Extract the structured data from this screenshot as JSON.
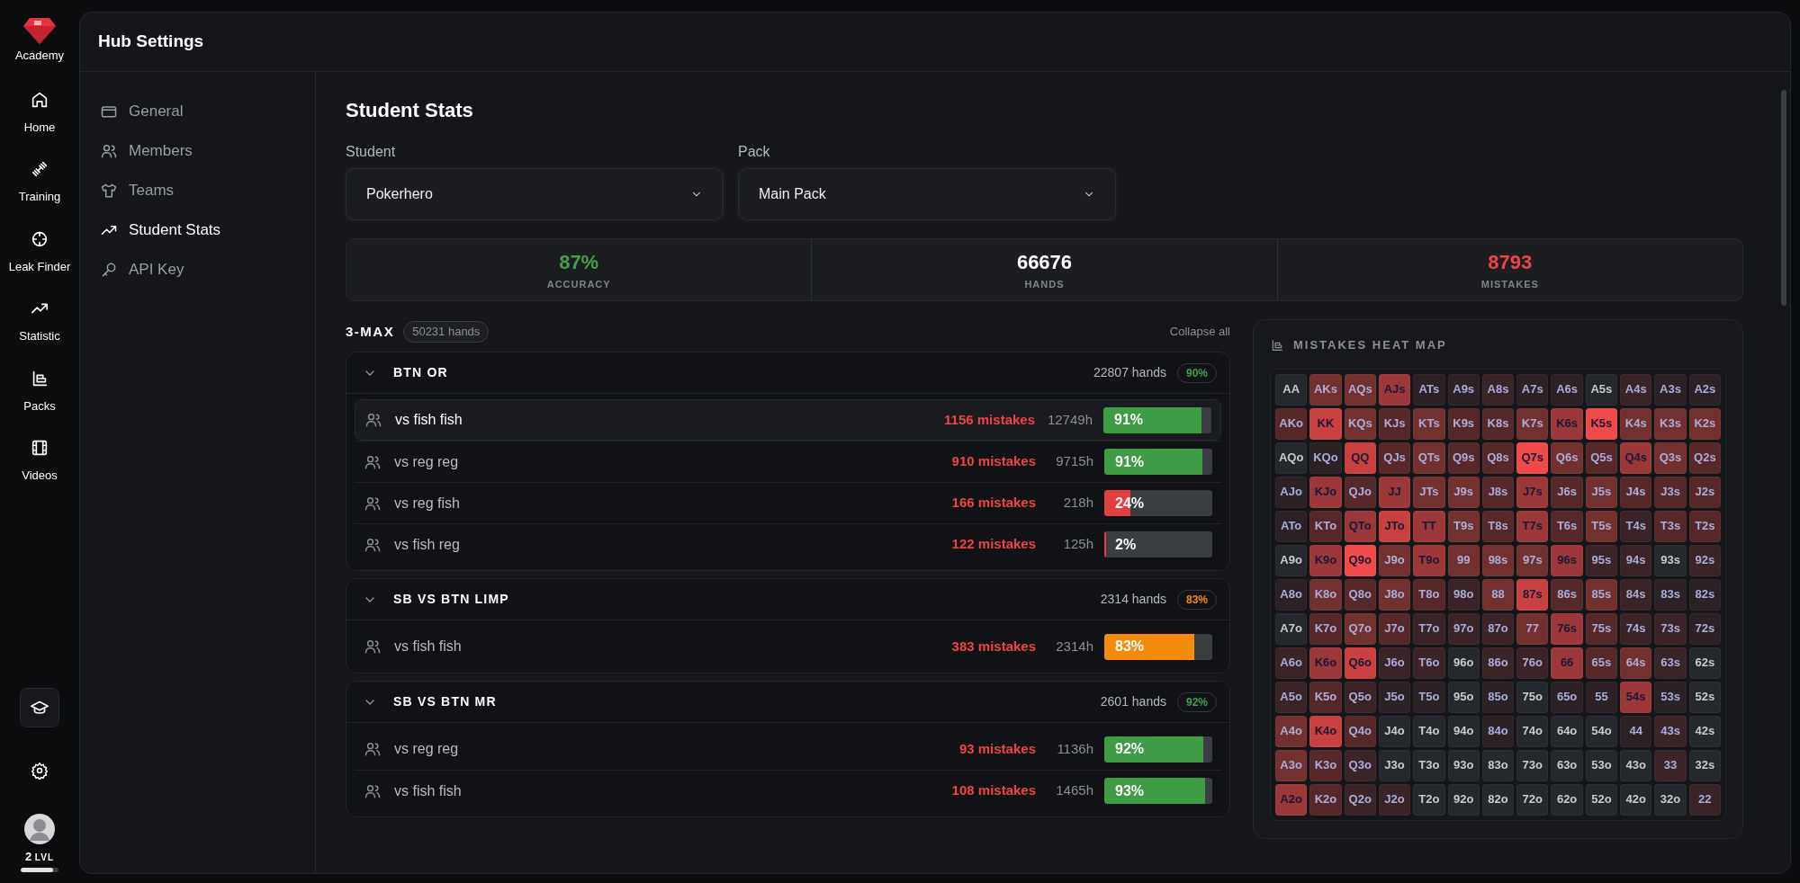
{
  "rail": {
    "logo_label": "Academy",
    "items": [
      {
        "label": "Home"
      },
      {
        "label": "Training"
      },
      {
        "label": "Leak Finder"
      },
      {
        "label": "Statistic"
      },
      {
        "label": "Packs"
      },
      {
        "label": "Videos"
      }
    ],
    "level": {
      "value": "2",
      "unit": "LVL",
      "level": 0.85
    }
  },
  "window": {
    "title": "Hub Settings"
  },
  "settings_nav": [
    {
      "label": "General",
      "selected": false
    },
    {
      "label": "Members",
      "selected": false
    },
    {
      "label": "Teams",
      "selected": false
    },
    {
      "label": "Student Stats",
      "selected": true
    },
    {
      "label": "API Key",
      "selected": false
    }
  ],
  "page_title": "Student Stats",
  "dropdowns": [
    {
      "label": "Student",
      "value": "Pokerhero"
    },
    {
      "label": "Pack",
      "value": "Main Pack"
    }
  ],
  "summary": [
    {
      "value": "87%",
      "label": "ACCURACY",
      "color": "#43a047"
    },
    {
      "value": "66676",
      "label": "HANDS",
      "color": "#ffffff"
    },
    {
      "value": "8793",
      "label": "MISTAKES",
      "color": "#ef4444"
    }
  ],
  "section": {
    "title": "3-MAX",
    "count": "50231 hands",
    "action": "Collapse all"
  },
  "groups": [
    {
      "title": "BTN OR",
      "hands": "22807 hands",
      "accuracy": "90%",
      "color": "#43a047",
      "expanded": true,
      "rows": [
        {
          "label": "vs fish fish",
          "mistakes": "1156 mistakes",
          "hands": "12749h",
          "percent": "91%",
          "level": 0.91,
          "color": "#3e9d44",
          "selected": true
        },
        {
          "label": "vs reg reg",
          "mistakes": "910 mistakes",
          "hands": "9715h",
          "percent": "91%",
          "level": 0.91,
          "color": "#3e9d44",
          "selected": false
        },
        {
          "label": "vs reg fish",
          "mistakes": "166 mistakes",
          "hands": "218h",
          "percent": "24%",
          "level": 0.24,
          "color": "#e04040",
          "selected": false
        },
        {
          "label": "vs fish reg",
          "mistakes": "122 mistakes",
          "hands": "125h",
          "percent": "2%",
          "level": 0.02,
          "color": "#e04040",
          "selected": false
        }
      ]
    },
    {
      "title": "SB VS BTN LIMP",
      "hands": "2314 hands",
      "accuracy": "83%",
      "color": "#f58a0b",
      "expanded": true,
      "rows": [
        {
          "label": "vs fish fish",
          "mistakes": "383 mistakes",
          "hands": "2314h",
          "percent": "83%",
          "level": 0.83,
          "color": "#f58a0b",
          "selected": false
        }
      ]
    },
    {
      "title": "SB VS BTN MR",
      "hands": "2601 hands",
      "accuracy": "92%",
      "color": "#43a047",
      "expanded": true,
      "rows": [
        {
          "label": "vs reg reg",
          "mistakes": "93 mistakes",
          "hands": "1136h",
          "percent": "92%",
          "level": 0.92,
          "color": "#3e9d44",
          "selected": false
        },
        {
          "label": "vs fish fish",
          "mistakes": "108 mistakes",
          "hands": "1465h",
          "percent": "93%",
          "level": 0.93,
          "color": "#3e9d44",
          "selected": false
        }
      ]
    }
  ],
  "heat_map": {
    "title": "MISTAKES HEAT MAP",
    "rows": [
      [
        {
          "label": "AA",
          "color": "#25282c"
        },
        {
          "label": "AKs",
          "color": "#72302f"
        },
        {
          "label": "AQs",
          "color": "#72302f"
        },
        {
          "label": "AJs",
          "color": "#9c3839"
        },
        {
          "label": "ATs",
          "color": "#2c2225"
        },
        {
          "label": "A9s",
          "color": "#2c2225"
        },
        {
          "label": "A8s",
          "color": "#3b2427"
        },
        {
          "label": "A7s",
          "color": "#2c2225"
        },
        {
          "label": "A6s",
          "color": "#2c2225"
        },
        {
          "label": "A5s",
          "color": "#25282c"
        },
        {
          "label": "A4s",
          "color": "#3b2427"
        },
        {
          "label": "A3s",
          "color": "#2c2225"
        },
        {
          "label": "A2s",
          "color": "#2c2225"
        }
      ],
      [
        {
          "label": "AKo",
          "color": "#562829"
        },
        {
          "label": "KK",
          "color": "#c84040"
        },
        {
          "label": "KQs",
          "color": "#72302f"
        },
        {
          "label": "KJs",
          "color": "#562829"
        },
        {
          "label": "KTs",
          "color": "#72302f"
        },
        {
          "label": "K9s",
          "color": "#562829"
        },
        {
          "label": "K8s",
          "color": "#562829"
        },
        {
          "label": "K7s",
          "color": "#72302f"
        },
        {
          "label": "K6s",
          "color": "#9c3839"
        },
        {
          "label": "K5s",
          "color": "#f04a4a"
        },
        {
          "label": "K4s",
          "color": "#72302f"
        },
        {
          "label": "K3s",
          "color": "#72302f"
        },
        {
          "label": "K2s",
          "color": "#72302f"
        }
      ],
      [
        {
          "label": "AQo",
          "color": "#25282c"
        },
        {
          "label": "KQo",
          "color": "#2c2225"
        },
        {
          "label": "QQ",
          "color": "#c84040"
        },
        {
          "label": "QJs",
          "color": "#562829"
        },
        {
          "label": "QTs",
          "color": "#72302f"
        },
        {
          "label": "Q9s",
          "color": "#562829"
        },
        {
          "label": "Q8s",
          "color": "#562829"
        },
        {
          "label": "Q7s",
          "color": "#f04a4a"
        },
        {
          "label": "Q6s",
          "color": "#72302f"
        },
        {
          "label": "Q5s",
          "color": "#562829"
        },
        {
          "label": "Q4s",
          "color": "#9c3839"
        },
        {
          "label": "Q3s",
          "color": "#72302f"
        },
        {
          "label": "Q2s",
          "color": "#562829"
        }
      ],
      [
        {
          "label": "AJo",
          "color": "#2c2225"
        },
        {
          "label": "KJo",
          "color": "#9c3839"
        },
        {
          "label": "QJo",
          "color": "#562829"
        },
        {
          "label": "JJ",
          "color": "#9c3839"
        },
        {
          "label": "JTs",
          "color": "#72302f"
        },
        {
          "label": "J9s",
          "color": "#72302f"
        },
        {
          "label": "J8s",
          "color": "#562829"
        },
        {
          "label": "J7s",
          "color": "#9c3839"
        },
        {
          "label": "J6s",
          "color": "#562829"
        },
        {
          "label": "J5s",
          "color": "#72302f"
        },
        {
          "label": "J4s",
          "color": "#562829"
        },
        {
          "label": "J3s",
          "color": "#562829"
        },
        {
          "label": "J2s",
          "color": "#562829"
        }
      ],
      [
        {
          "label": "ATo",
          "color": "#2c2225"
        },
        {
          "label": "KTo",
          "color": "#562829"
        },
        {
          "label": "QTo",
          "color": "#9c3839"
        },
        {
          "label": "JTo",
          "color": "#c84040"
        },
        {
          "label": "TT",
          "color": "#9c3839"
        },
        {
          "label": "T9s",
          "color": "#72302f"
        },
        {
          "label": "T8s",
          "color": "#562829"
        },
        {
          "label": "T7s",
          "color": "#9c3839"
        },
        {
          "label": "T6s",
          "color": "#562829"
        },
        {
          "label": "T5s",
          "color": "#72302f"
        },
        {
          "label": "T4s",
          "color": "#3b2427"
        },
        {
          "label": "T3s",
          "color": "#562829"
        },
        {
          "label": "T2s",
          "color": "#562829"
        }
      ],
      [
        {
          "label": "A9o",
          "color": "#25282c"
        },
        {
          "label": "K9o",
          "color": "#9c3839"
        },
        {
          "label": "Q9o",
          "color": "#f04a4a"
        },
        {
          "label": "J9o",
          "color": "#72302f"
        },
        {
          "label": "T9o",
          "color": "#9c3839"
        },
        {
          "label": "99",
          "color": "#72302f"
        },
        {
          "label": "98s",
          "color": "#72302f"
        },
        {
          "label": "97s",
          "color": "#72302f"
        },
        {
          "label": "96s",
          "color": "#9c3839"
        },
        {
          "label": "95s",
          "color": "#3b2427"
        },
        {
          "label": "94s",
          "color": "#3b2427"
        },
        {
          "label": "93s",
          "color": "#25282c"
        },
        {
          "label": "92s",
          "color": "#3b2427"
        }
      ],
      [
        {
          "label": "A8o",
          "color": "#2c2225"
        },
        {
          "label": "K8o",
          "color": "#72302f"
        },
        {
          "label": "Q8o",
          "color": "#562829"
        },
        {
          "label": "J8o",
          "color": "#72302f"
        },
        {
          "label": "T8o",
          "color": "#562829"
        },
        {
          "label": "98o",
          "color": "#3b2427"
        },
        {
          "label": "88",
          "color": "#72302f"
        },
        {
          "label": "87s",
          "color": "#c84040"
        },
        {
          "label": "86s",
          "color": "#562829"
        },
        {
          "label": "85s",
          "color": "#72302f"
        },
        {
          "label": "84s",
          "color": "#3b2427"
        },
        {
          "label": "83s",
          "color": "#2c2225"
        },
        {
          "label": "82s",
          "color": "#2c2225"
        }
      ],
      [
        {
          "label": "A7o",
          "color": "#25282c"
        },
        {
          "label": "K7o",
          "color": "#562829"
        },
        {
          "label": "Q7o",
          "color": "#72302f"
        },
        {
          "label": "J7o",
          "color": "#562829"
        },
        {
          "label": "T7o",
          "color": "#3b2427"
        },
        {
          "label": "97o",
          "color": "#3b2427"
        },
        {
          "label": "87o",
          "color": "#3b2427"
        },
        {
          "label": "77",
          "color": "#72302f"
        },
        {
          "label": "76s",
          "color": "#9c3839"
        },
        {
          "label": "75s",
          "color": "#562829"
        },
        {
          "label": "74s",
          "color": "#3b2427"
        },
        {
          "label": "73s",
          "color": "#3b2427"
        },
        {
          "label": "72s",
          "color": "#2c2225"
        }
      ],
      [
        {
          "label": "A6o",
          "color": "#3b2427"
        },
        {
          "label": "K6o",
          "color": "#9c3839"
        },
        {
          "label": "Q6o",
          "color": "#c84040"
        },
        {
          "label": "J6o",
          "color": "#3b2427"
        },
        {
          "label": "T6o",
          "color": "#3b2427"
        },
        {
          "label": "96o",
          "color": "#25282c"
        },
        {
          "label": "86o",
          "color": "#3b2427"
        },
        {
          "label": "76o",
          "color": "#3b2427"
        },
        {
          "label": "66",
          "color": "#9c3839"
        },
        {
          "label": "65s",
          "color": "#562829"
        },
        {
          "label": "64s",
          "color": "#72302f"
        },
        {
          "label": "63s",
          "color": "#3b2427"
        },
        {
          "label": "62s",
          "color": "#25282c"
        }
      ],
      [
        {
          "label": "A5o",
          "color": "#3b2427"
        },
        {
          "label": "K5o",
          "color": "#562829"
        },
        {
          "label": "Q5o",
          "color": "#3b2427"
        },
        {
          "label": "J5o",
          "color": "#2c2225"
        },
        {
          "label": "T5o",
          "color": "#2c2225"
        },
        {
          "label": "95o",
          "color": "#25282c"
        },
        {
          "label": "85o",
          "color": "#2c2225"
        },
        {
          "label": "75o",
          "color": "#25282c"
        },
        {
          "label": "65o",
          "color": "#2c2225"
        },
        {
          "label": "55",
          "color": "#2c2225"
        },
        {
          "label": "54s",
          "color": "#9c3839"
        },
        {
          "label": "53s",
          "color": "#2c2225"
        },
        {
          "label": "52s",
          "color": "#25282c"
        }
      ],
      [
        {
          "label": "A4o",
          "color": "#72302f"
        },
        {
          "label": "K4o",
          "color": "#c84040"
        },
        {
          "label": "Q4o",
          "color": "#562829"
        },
        {
          "label": "J4o",
          "color": "#25282c"
        },
        {
          "label": "T4o",
          "color": "#25282c"
        },
        {
          "label": "94o",
          "color": "#25282c"
        },
        {
          "label": "84o",
          "color": "#2c2225"
        },
        {
          "label": "74o",
          "color": "#25282c"
        },
        {
          "label": "64o",
          "color": "#25282c"
        },
        {
          "label": "54o",
          "color": "#25282c"
        },
        {
          "label": "44",
          "color": "#2c2225"
        },
        {
          "label": "43s",
          "color": "#3b2427"
        },
        {
          "label": "42s",
          "color": "#25282c"
        }
      ],
      [
        {
          "label": "A3o",
          "color": "#72302f"
        },
        {
          "label": "K3o",
          "color": "#562829"
        },
        {
          "label": "Q3o",
          "color": "#3b2427"
        },
        {
          "label": "J3o",
          "color": "#25282c"
        },
        {
          "label": "T3o",
          "color": "#25282c"
        },
        {
          "label": "93o",
          "color": "#25282c"
        },
        {
          "label": "83o",
          "color": "#25282c"
        },
        {
          "label": "73o",
          "color": "#25282c"
        },
        {
          "label": "63o",
          "color": "#25282c"
        },
        {
          "label": "53o",
          "color": "#25282c"
        },
        {
          "label": "43o",
          "color": "#25282c"
        },
        {
          "label": "33",
          "color": "#3b2427"
        },
        {
          "label": "32s",
          "color": "#25282c"
        }
      ],
      [
        {
          "label": "A2o",
          "color": "#9c3839"
        },
        {
          "label": "K2o",
          "color": "#562829"
        },
        {
          "label": "Q2o",
          "color": "#3b2427"
        },
        {
          "label": "J2o",
          "color": "#3b2427"
        },
        {
          "label": "T2o",
          "color": "#25282c"
        },
        {
          "label": "92o",
          "color": "#25282c"
        },
        {
          "label": "82o",
          "color": "#25282c"
        },
        {
          "label": "72o",
          "color": "#25282c"
        },
        {
          "label": "62o",
          "color": "#25282c"
        },
        {
          "label": "52o",
          "color": "#25282c"
        },
        {
          "label": "42o",
          "color": "#25282c"
        },
        {
          "label": "32o",
          "color": "#25282c"
        },
        {
          "label": "22",
          "color": "#3b2427"
        }
      ]
    ]
  }
}
